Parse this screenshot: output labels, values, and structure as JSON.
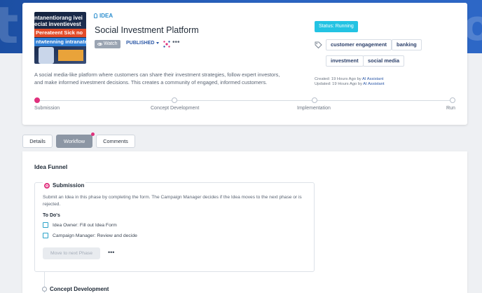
{
  "hero": {
    "ghost_left": "t",
    "ghost_right": "to"
  },
  "idea": {
    "type_label": "IDEA",
    "title": "Social Investment Platform",
    "watch_label": "Watch",
    "publish_status": "PUBLISHED",
    "more_label": "•••",
    "status_badge": "Status: Running",
    "tags": [
      "customer engagement",
      "banking",
      "investment",
      "social media"
    ],
    "description": "A social media-like platform where customers can share their investment strategies, follow expert investors, and make informed investment decisions. This creates a community of engaged, informed customers.",
    "created": {
      "prefix": "Created: 19 Hours Ago by ",
      "author": "AI Assistant"
    },
    "updated": {
      "prefix": "Updated: 19 Hours Ago by ",
      "author": "AI Assistant"
    },
    "thumbnail_text": {
      "line1": "ntanentiorang ivei",
      "line2": "eciat inventievest",
      "line3": "Pereateent Sick no",
      "line4": "ntwtenning intranate"
    }
  },
  "progress": {
    "steps": [
      "Submission",
      "Concept Development",
      "Implementation",
      "Run"
    ],
    "active_index": 0
  },
  "tabs": [
    "Details",
    "Workflow",
    "Comments"
  ],
  "funnel": {
    "title": "Idea Funnel",
    "phase": {
      "name": "Submission",
      "description": "Submit an Idea in this phase by completing the form. The Campaign Manager decides if the Idea moves to the next phase or is rejected.",
      "todo_title": "To Do's",
      "todos": [
        "Idea Owner: Fill out Idea Form",
        "Campaign Manager: Review and decide"
      ],
      "move_button": "Move to next Phase",
      "more_label": "•••"
    },
    "next_phase": "Concept Development"
  },
  "colors": {
    "accent_pink": "#e0317d",
    "status_cyan": "#23c3e3",
    "link_blue": "#2e5aa8"
  }
}
